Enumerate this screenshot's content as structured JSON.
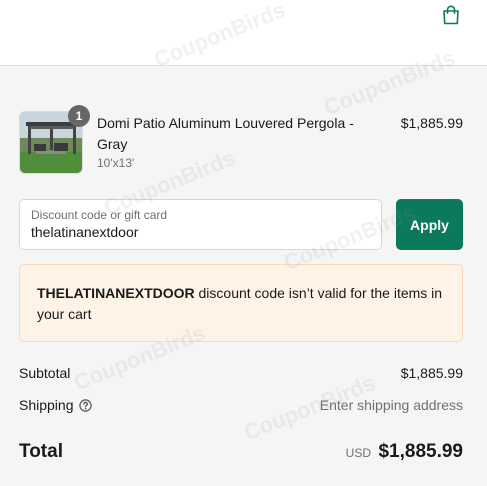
{
  "header": {
    "cart_icon": "shopping-bag-icon",
    "accent": "#0b7a5c"
  },
  "product": {
    "quantity": "1",
    "name": "Domi Patio Aluminum Louvered Pergola - Gray",
    "variant": "10'x13'",
    "price": "$1,885.99"
  },
  "discount": {
    "placeholder": "Discount code or gift card",
    "value": "thelatinanextdoor",
    "apply_label": "Apply"
  },
  "error": {
    "code": "THELATINANEXTDOOR",
    "message": " discount code isn’t valid for the items in your cart"
  },
  "summary": {
    "subtotal_label": "Subtotal",
    "subtotal_value": "$1,885.99",
    "shipping_label": "Shipping",
    "shipping_value": "Enter shipping address",
    "total_label": "Total",
    "total_currency": "USD",
    "total_value": "$1,885.99"
  },
  "watermark": "CouponBirds"
}
